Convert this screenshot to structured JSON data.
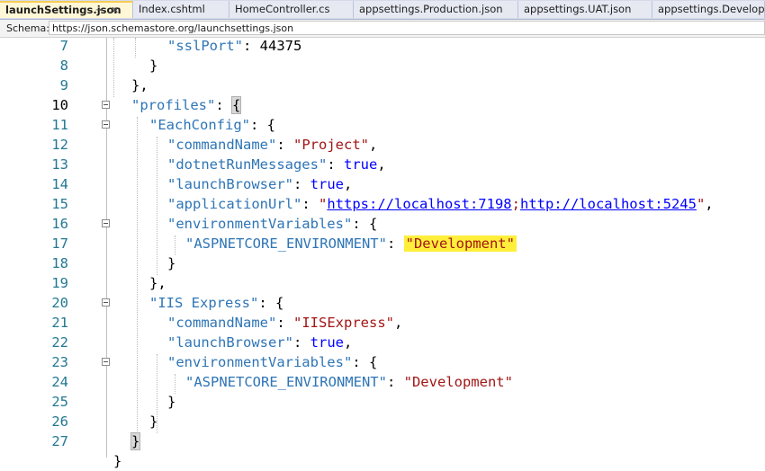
{
  "tabs": [
    {
      "label": "launchSettings.json",
      "active": true
    },
    {
      "label": "Index.cshtml",
      "active": false
    },
    {
      "label": "HomeController.cs",
      "active": false
    },
    {
      "label": "appsettings.Production.json",
      "active": false
    },
    {
      "label": "appsettings.UAT.json",
      "active": false
    },
    {
      "label": "appsettings.Development.json",
      "active": false
    }
  ],
  "active_tab_icons": {
    "pin": "pin-icon",
    "close": "close-icon"
  },
  "schema": {
    "label": "Schema:",
    "value": "https://json.schemastore.org/launchsettings.json"
  },
  "editor": {
    "line_numbers": [
      "7",
      "8",
      "9",
      "10",
      "11",
      "12",
      "13",
      "14",
      "15",
      "16",
      "17",
      "18",
      "19",
      "20",
      "21",
      "22",
      "23",
      "24",
      "25",
      "26",
      "27"
    ],
    "current_line": "10",
    "tokens": {
      "l7_key": "\"sslPort\"",
      "l7_val": "44375",
      "l10_key": "\"profiles\"",
      "l11_key": "\"EachConfig\"",
      "l12_key": "\"commandName\"",
      "l12_val": "\"Project\"",
      "l13_key": "\"dotnetRunMessages\"",
      "l13_val": "true",
      "l14_key": "\"launchBrowser\"",
      "l14_val": "true",
      "l15_key": "\"applicationUrl\"",
      "l15_url1": "https://localhost:7198",
      "l15_url2": "http://localhost:5245",
      "l16_key": "\"environmentVariables\"",
      "l17_key": "\"ASPNETCORE_ENVIRONMENT\"",
      "l17_val": "\"Development\"",
      "l20_key": "\"IIS Express\"",
      "l21_key": "\"commandName\"",
      "l21_val": "\"IISExpress\"",
      "l22_key": "\"launchBrowser\"",
      "l22_val": "true",
      "l23_key": "\"environmentVariables\"",
      "l24_key": "\"ASPNETCORE_ENVIRONMENT\"",
      "l24_val": "\"Development\""
    },
    "highlight_color": "#ffef3a"
  },
  "colors": {
    "key": "#2e75b6",
    "string": "#a31515",
    "literal": "#0000ff",
    "line_number": "#237893",
    "active_tab_accent": "#f5cc58"
  }
}
